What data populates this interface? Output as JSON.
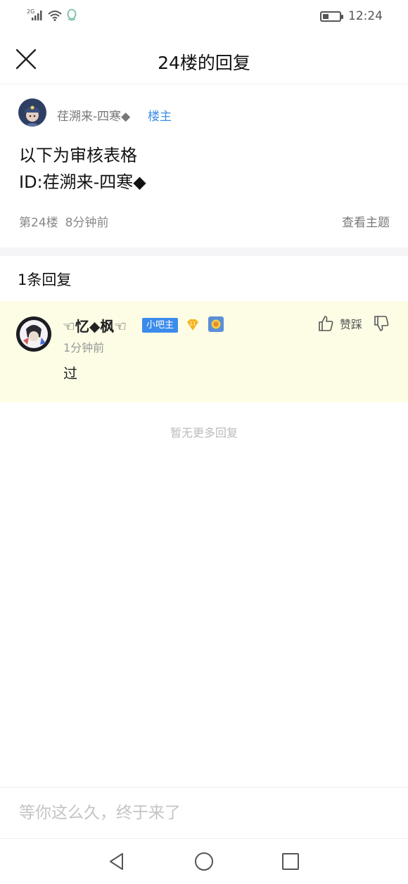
{
  "status_bar": {
    "network": "2G",
    "time": "12:24",
    "battery_level": 0.35
  },
  "header": {
    "title": "24楼的回复"
  },
  "post": {
    "author": "荏溯来-四寒◆",
    "owner_tag": "楼主",
    "content_lines": [
      "以下为审核表格",
      "ID:荏溯来-四寒◆"
    ],
    "floor": "第24楼",
    "time": "8分钟前",
    "view_topic_label": "查看主题"
  },
  "replies": {
    "count_label": "1条回复",
    "items": [
      {
        "username": "☜忆◆枫☜",
        "role_badge": "小吧主",
        "level": "11",
        "time": "1分钟前",
        "text": "过",
        "like_label": "赞踩"
      }
    ],
    "end_label": "暂无更多回复"
  },
  "input": {
    "placeholder": "等你这么久，终于来了"
  },
  "colors": {
    "accent_blue": "#3d8fe4",
    "reply_highlight": "#fdfde6",
    "badge_blue": "#3b8beb",
    "level_gold": "#f3b51f"
  }
}
